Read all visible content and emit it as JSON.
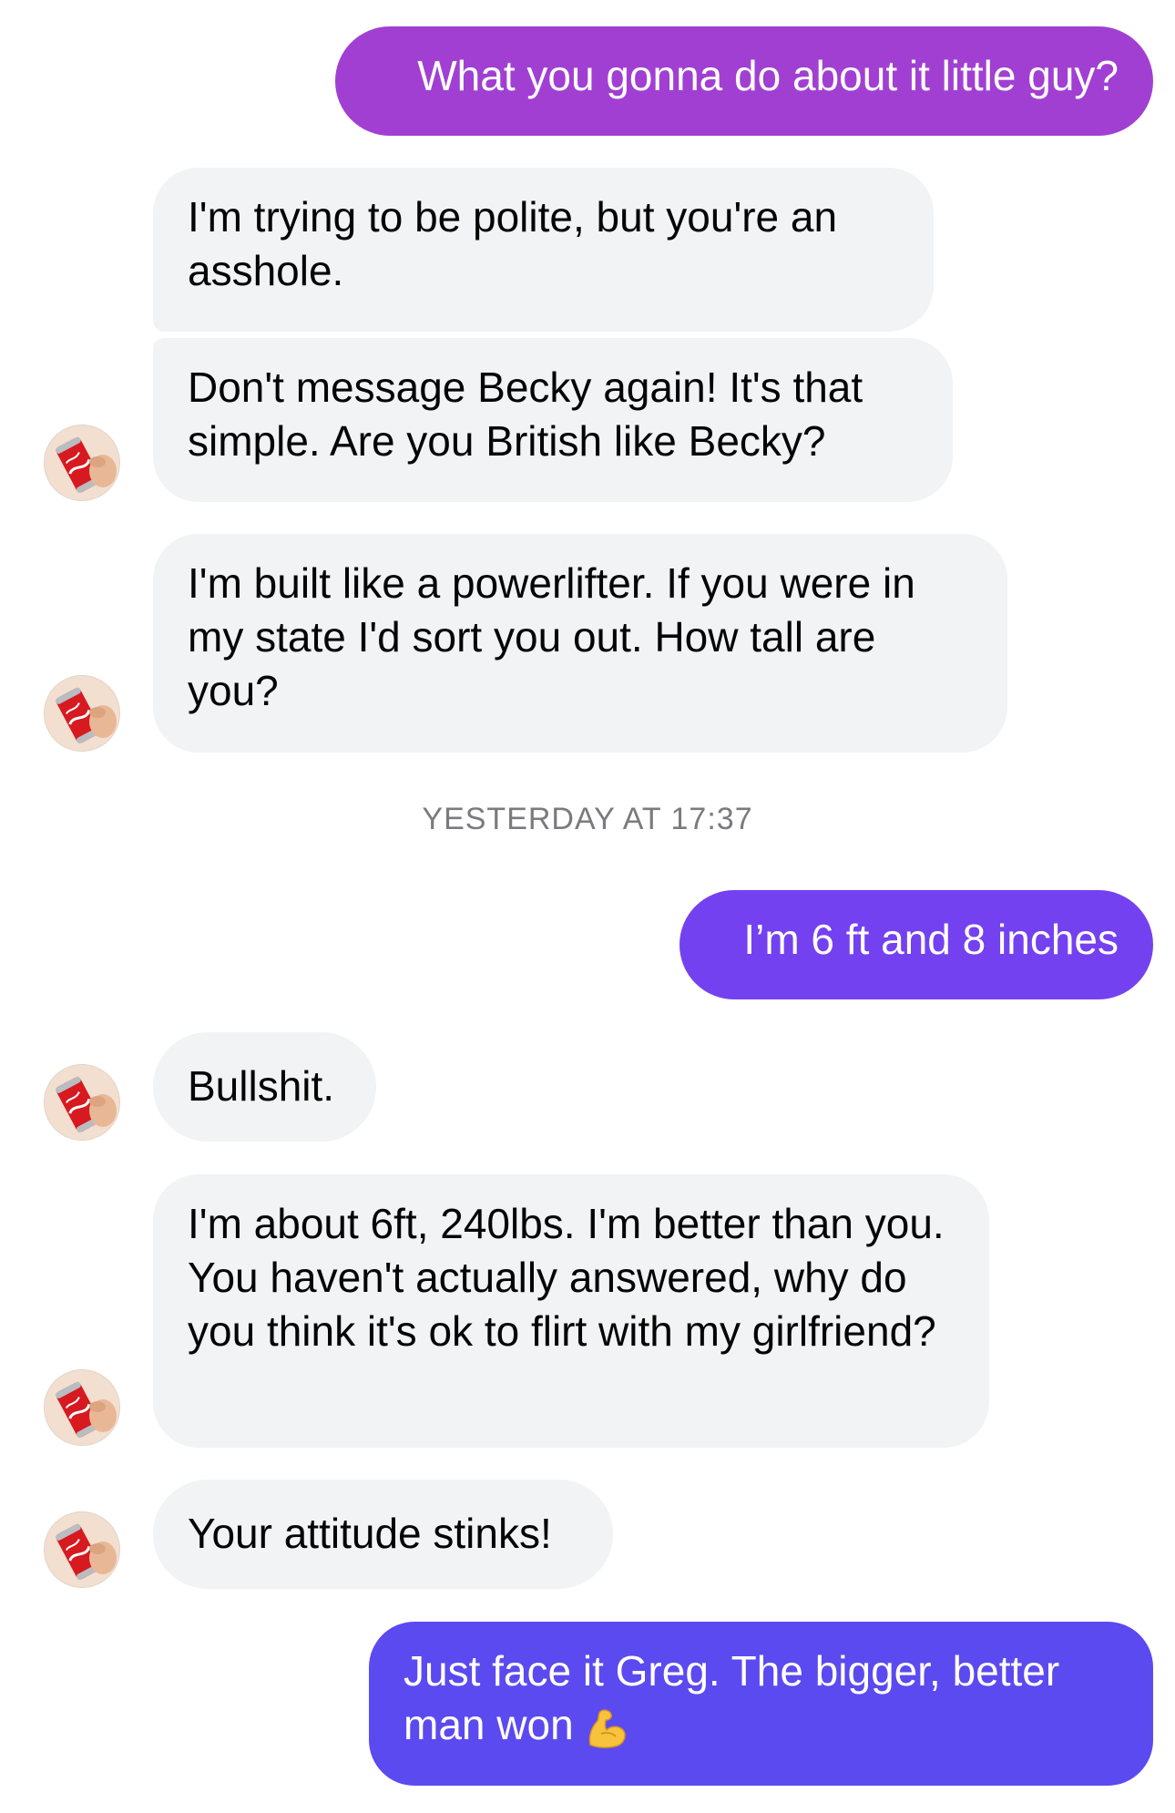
{
  "messages": [
    {
      "text": "What you gonna do about it little guy?"
    },
    {
      "text": "I'm trying to be polite, but you're an asshole."
    },
    {
      "text": "Don't message Becky again! It's that simple. Are you British like Becky?"
    },
    {
      "text": "I'm built like a powerlifter. If you were in my state I'd sort you out. How tall are you?"
    },
    {
      "text": "I’m 6 ft and 8 inches"
    },
    {
      "text": "Bullshit."
    },
    {
      "text": "I'm about 6ft, 240lbs. I'm better than you. You haven't actually answered, why do you think it's ok to flirt with my girlfriend?"
    },
    {
      "text": "Your attitude stinks!"
    },
    {
      "text": "Just face it Greg. The bigger, better man won",
      "emoji": "flexed-biceps-icon"
    }
  ],
  "timestamp": "YESTERDAY AT 17:37",
  "avatar": {
    "icon": "cola-can-icon"
  },
  "colors": {
    "outgoing_1": "#a13fd3",
    "outgoing_2": "#7441f0",
    "outgoing_3": "#5b4af0",
    "incoming": "#f1f3f4",
    "timestamp": "#7a7a7f"
  }
}
